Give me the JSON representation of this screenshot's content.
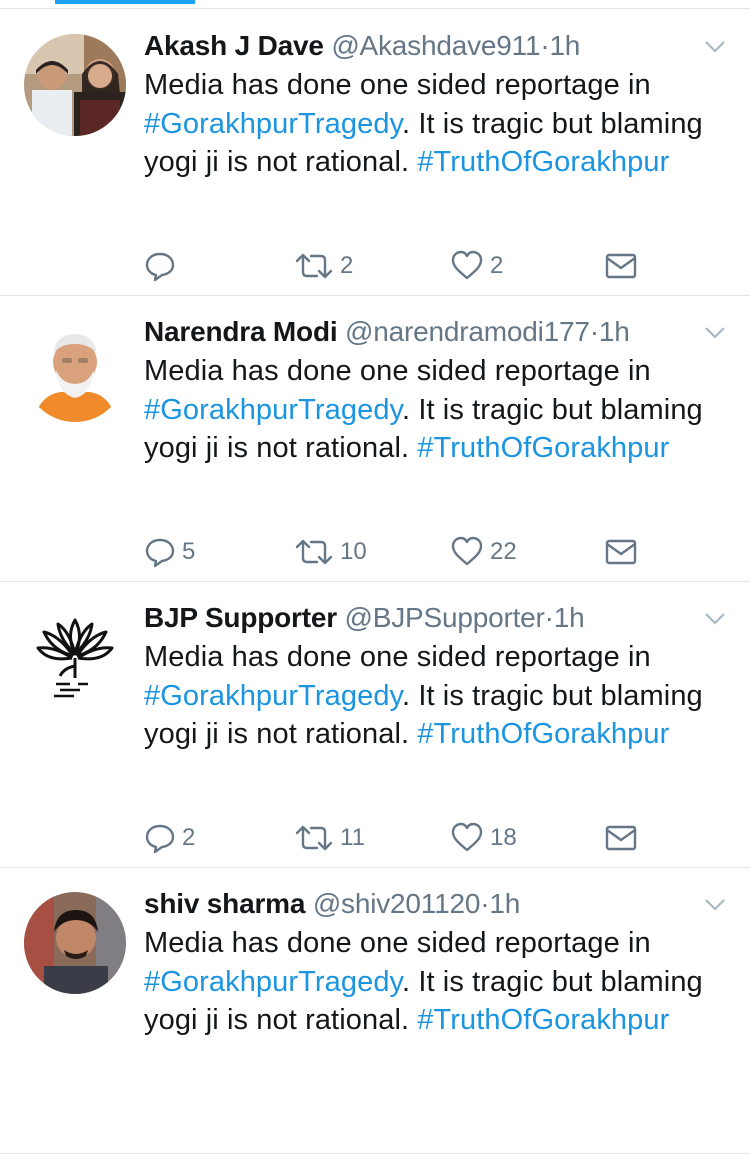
{
  "colors": {
    "accent": "#1da1f2",
    "hashtag": "#1b95e0",
    "muted": "#657786",
    "text": "#14171a",
    "divider": "#e1e8ed"
  },
  "tweets": [
    {
      "name": "Akash J Dave",
      "handle": "@Akashdave911",
      "separator": "·",
      "time": "1h",
      "text_before": "Media has done one sided reportage in ",
      "hashtag1": "#GorakhpurTragedy",
      "text_middle": ". It is tragic but blaming yogi ji is not rational. ",
      "hashtag2": "#TruthOfGorakhpur",
      "replies": "",
      "retweets": "2",
      "likes": "2",
      "avatar": "photo-two-people"
    },
    {
      "name": "Narendra Modi",
      "handle": "@narendramodi177",
      "separator": "·",
      "time": "1h",
      "text_before": "Media has done one sided reportage in ",
      "hashtag1": "#GorakhpurTragedy",
      "text_middle": ". It is tragic but blaming yogi ji is not rational. ",
      "hashtag2": "#TruthOfGorakhpur",
      "replies": "5",
      "retweets": "10",
      "likes": "22",
      "avatar": "photo-man-white-beard"
    },
    {
      "name": "BJP Supporter",
      "handle": "@BJPSupporter",
      "separator": "·",
      "time": "1h",
      "text_before": "Media has done one sided reportage in ",
      "hashtag1": "#GorakhpurTragedy",
      "text_middle": ". It is tragic but blaming yogi ji is not rational. ",
      "hashtag2": "#TruthOfGorakhpur",
      "replies": "2",
      "retweets": "11",
      "likes": "18",
      "avatar": "lotus-logo"
    },
    {
      "name": "shiv sharma",
      "handle": "@shiv201120",
      "separator": "·",
      "time": "1h",
      "text_before": "Media has done one sided reportage in ",
      "hashtag1": "#GorakhpurTragedy",
      "text_middle": ". It is tragic but blaming yogi ji is not rational. ",
      "hashtag2": "#TruthOfGorakhpur",
      "replies": "",
      "retweets": "",
      "likes": "",
      "avatar": "photo-young-man"
    }
  ]
}
